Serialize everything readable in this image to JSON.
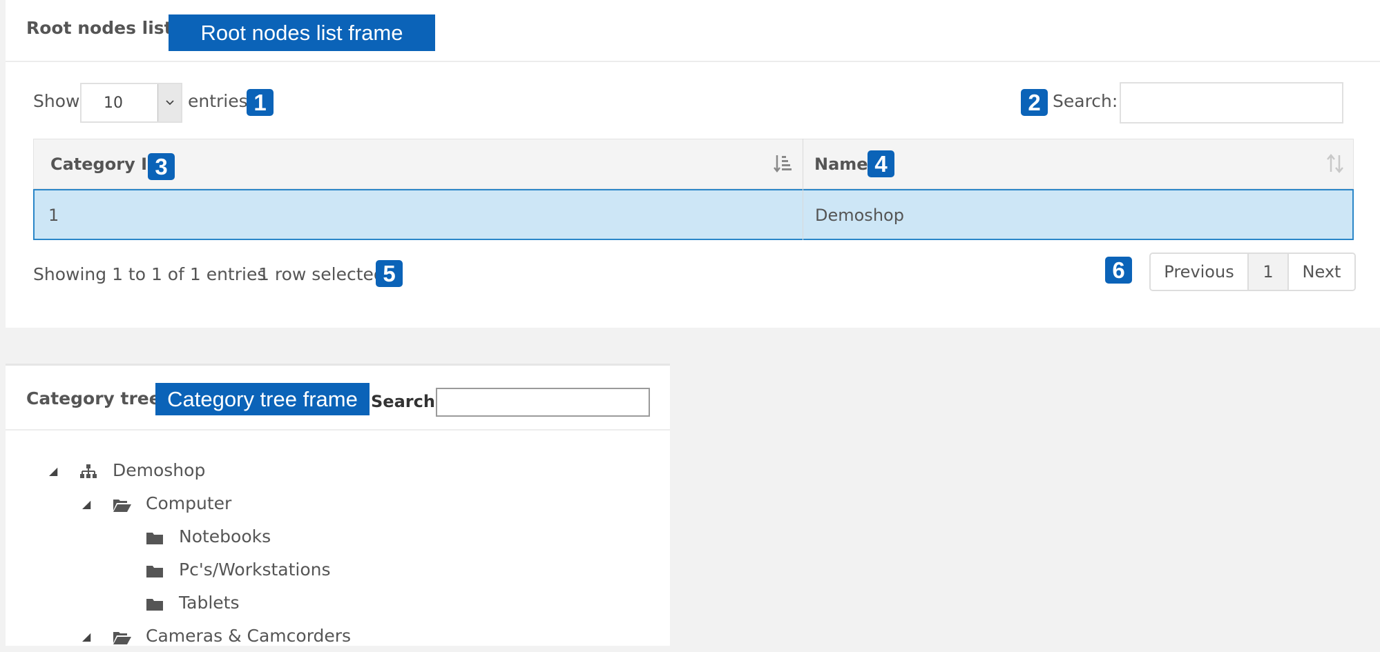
{
  "root_panel": {
    "title": "Root nodes list",
    "frame_tag": "Root nodes list frame",
    "length": {
      "show_label": "Show",
      "value": "10",
      "entries_label": "entries"
    },
    "search_label": "Search:",
    "search_value": "",
    "table": {
      "columns": [
        {
          "label": "Category Id"
        },
        {
          "label": "Name"
        }
      ],
      "rows": [
        {
          "id": "1",
          "name": "Demoshop"
        }
      ]
    },
    "info": "Showing 1 to 1 of 1 entries",
    "selected_info": "1 row selected",
    "pagination": {
      "previous": "Previous",
      "page": "1",
      "next": "Next"
    },
    "badges": [
      "1",
      "2",
      "3",
      "4",
      "5",
      "6"
    ]
  },
  "tree_panel": {
    "title": "Category tree",
    "frame_tag": "Category tree frame",
    "search_label": "Search:",
    "search_value": "",
    "items": [
      {
        "label": "Demoshop",
        "icon": "sitemap-icon",
        "expanded": true
      },
      {
        "label": "Computer",
        "icon": "folder-open-icon",
        "expanded": true
      },
      {
        "label": "Notebooks",
        "icon": "folder-icon"
      },
      {
        "label": "Pc's/Workstations",
        "icon": "folder-icon"
      },
      {
        "label": "Tablets",
        "icon": "folder-icon"
      },
      {
        "label": "Cameras & Camcorders",
        "icon": "folder-open-icon",
        "expanded": true
      }
    ]
  },
  "colors": {
    "accent": "#0b63b8",
    "selected_row_bg": "#cde6f6",
    "selected_row_border": "#2a86c8",
    "page_bg": "#f2f2f2"
  }
}
